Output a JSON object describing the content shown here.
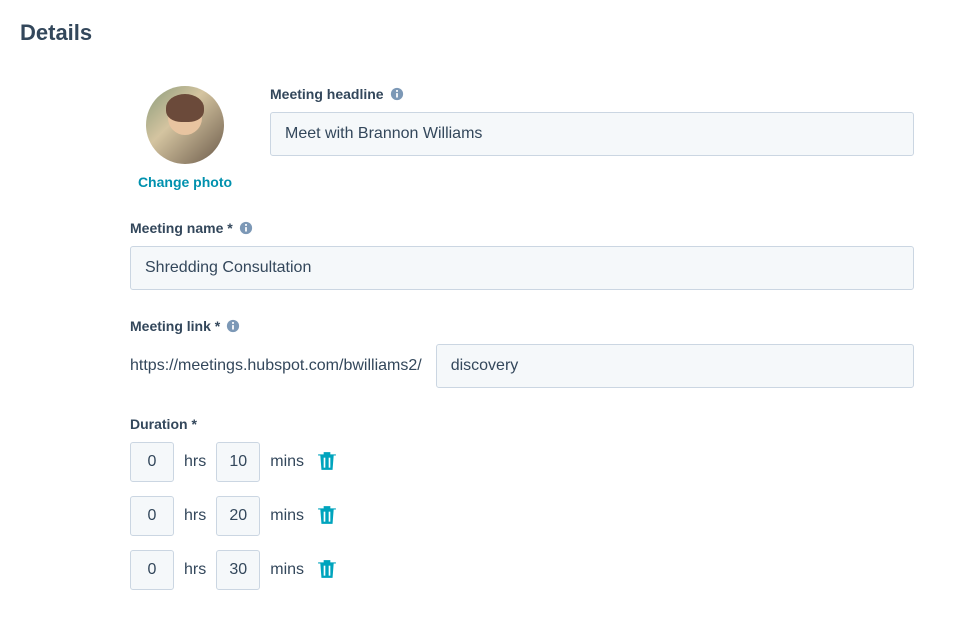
{
  "page": {
    "title": "Details"
  },
  "photo": {
    "change_label": "Change photo"
  },
  "headline": {
    "label": "Meeting headline",
    "value": "Meet with Brannon Williams"
  },
  "meeting_name": {
    "label": "Meeting name *",
    "value": "Shredding Consultation"
  },
  "meeting_link": {
    "label": "Meeting link *",
    "prefix": "https://meetings.hubspot.com/bwilliams2/",
    "value": "discovery"
  },
  "duration": {
    "label": "Duration *",
    "hrs_unit": "hrs",
    "mins_unit": "mins",
    "rows": [
      {
        "hrs": "0",
        "mins": "10"
      },
      {
        "hrs": "0",
        "mins": "20"
      },
      {
        "hrs": "0",
        "mins": "30"
      }
    ]
  }
}
